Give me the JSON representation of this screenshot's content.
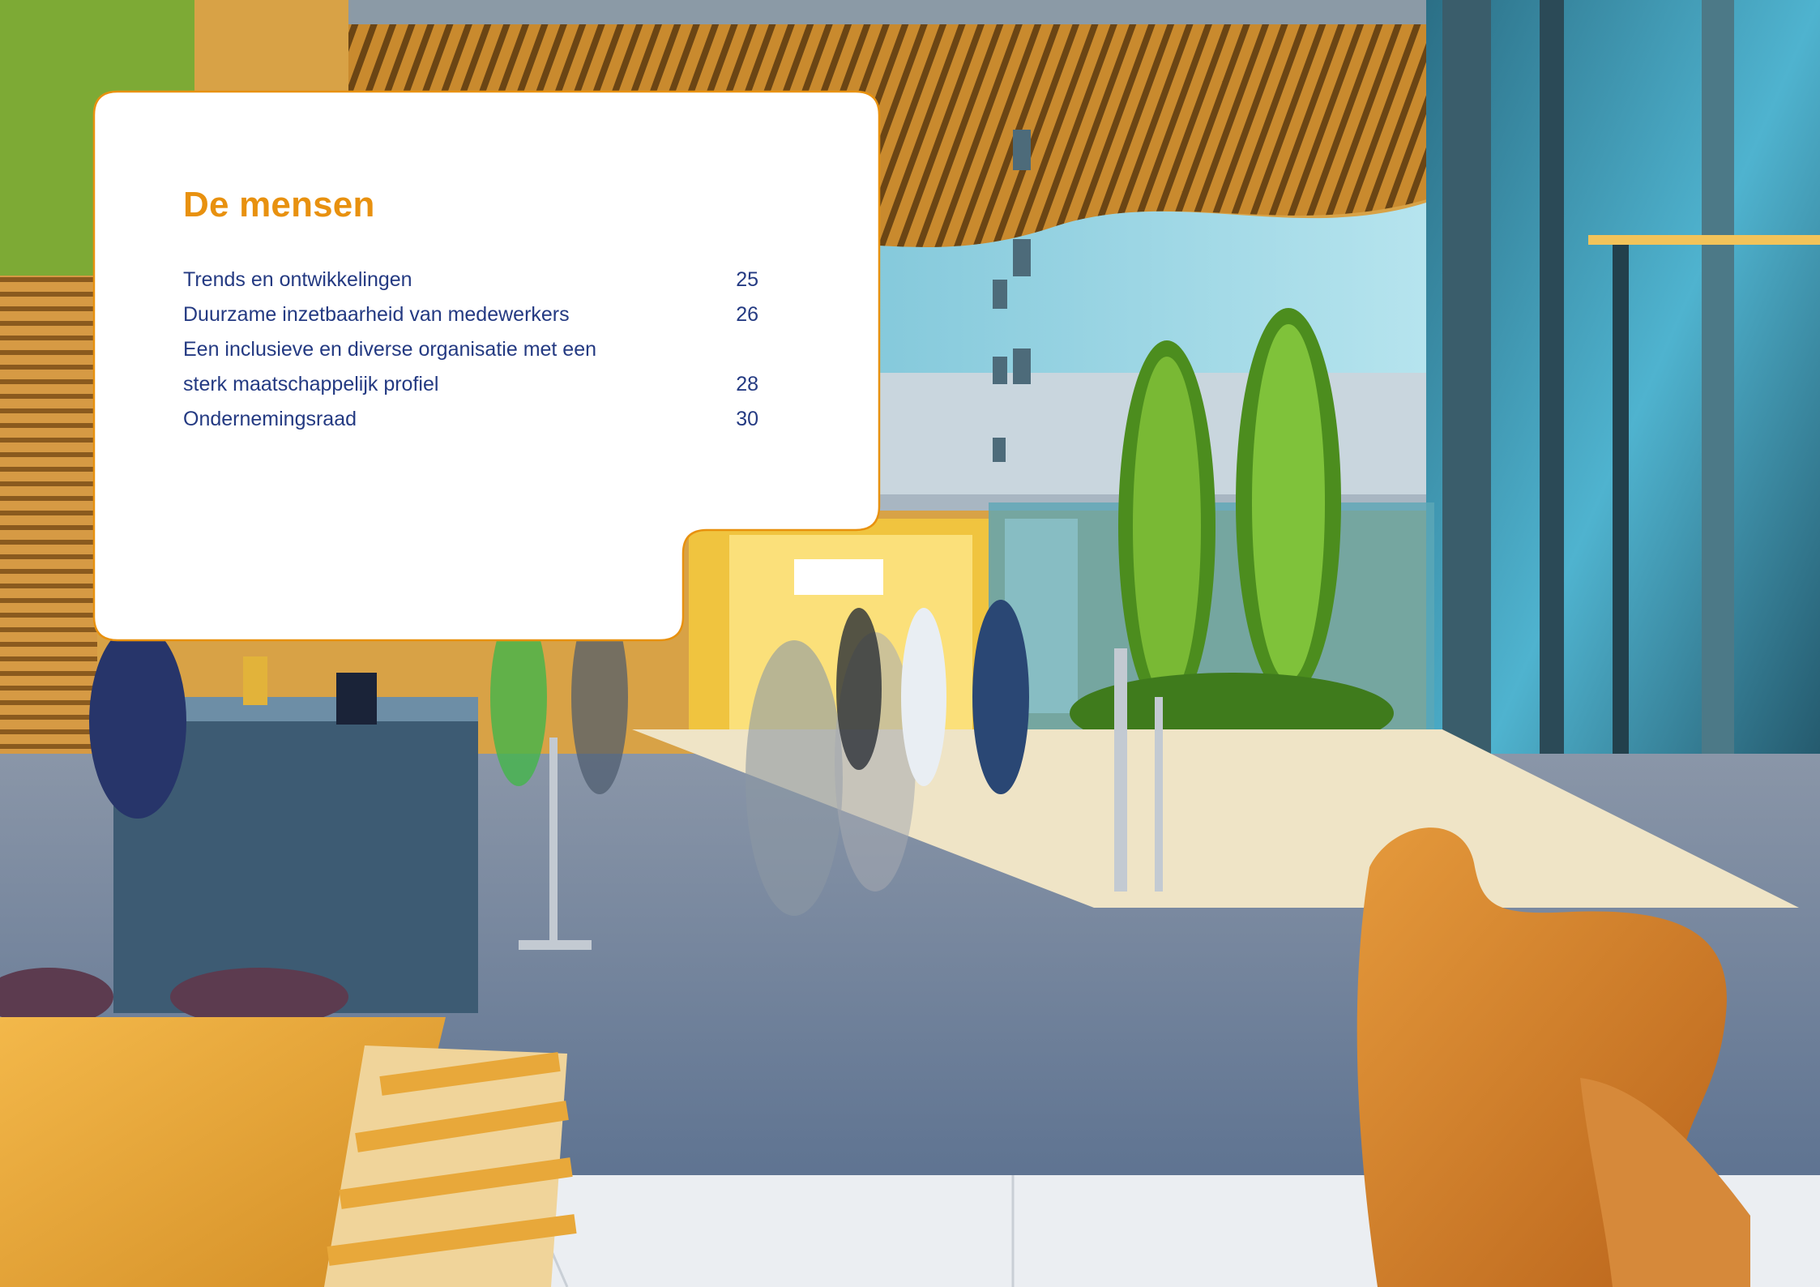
{
  "section": {
    "title": "De mensen",
    "entries": [
      {
        "label": "Trends en ontwikkelingen",
        "page": "25"
      },
      {
        "label": "Duurzame inzetbaarheid van medewerkers",
        "page": "26"
      },
      {
        "label": "Een inclusieve en diverse organisatie met een",
        "page": ""
      },
      {
        "label": "sterk maatschappelijk profiel",
        "page": "28"
      },
      {
        "label": "Ondernemingsraad",
        "page": "30"
      }
    ]
  },
  "colors": {
    "title": "#e8910f",
    "entry_text": "#243a82",
    "card_border": "#e8910f",
    "card_background": "#ffffff"
  },
  "background_photo": "office-atrium-photo"
}
